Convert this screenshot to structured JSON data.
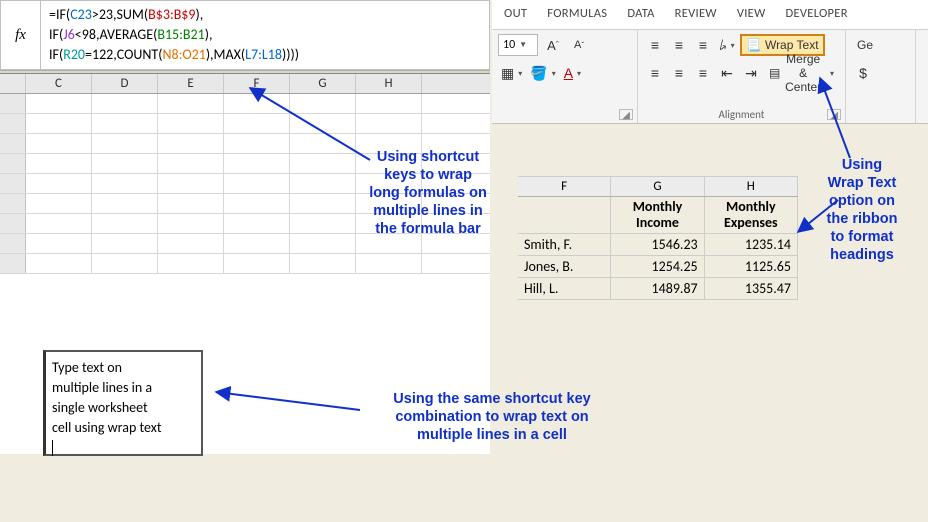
{
  "left": {
    "fx": "fx",
    "line1_pre": "=IF(",
    "line1_ref1": "C23",
    "line1_mid1": ">23,SUM(",
    "line1_ref2": "B$3:B$9",
    "line1_post": "),",
    "line2_pre": "IF(",
    "line2_ref1": "J6",
    "line2_mid1": "<98,AVERAGE(",
    "line2_ref2": "B15:B21",
    "line2_post": "),",
    "line3_pre": "IF(",
    "line3_ref1": "R20",
    "line3_mid1": "=122,COUNT(",
    "line3_ref2": "N8:O21",
    "line3_mid2": "),MAX(",
    "line3_ref3": "L7:L18",
    "line3_post": "))))",
    "cols": [
      "",
      "C",
      "D",
      "E",
      "F",
      "G",
      "H"
    ]
  },
  "wrap_cell_text": "Type text on\nmultiple lines in a\nsingle worksheet\ncell using wrap text",
  "ribbon": {
    "tabs": [
      "OUT",
      "FORMULAS",
      "DATA",
      "REVIEW",
      "VIEW",
      "DEVELOPER"
    ],
    "font_size": "10",
    "align_label": "Alignment",
    "wrap_text": "Wrap Text",
    "merge_center": "Merge & Center",
    "general_partial": "Ge",
    "dollar": "$"
  },
  "chart_data": {
    "type": "table",
    "columns": [
      "",
      "Monthly Income",
      "Monthly Expenses"
    ],
    "col_letters": [
      "F",
      "G",
      "H"
    ],
    "rows": [
      {
        "name": "Smith, F.",
        "income": "1546.23",
        "expenses": "1235.14"
      },
      {
        "name": "Jones, B.",
        "income": "1254.25",
        "expenses": "1125.65"
      },
      {
        "name": "Hill, L.",
        "income": "1489.87",
        "expenses": "1355.47"
      }
    ]
  },
  "annot": {
    "a1": "Using shortcut\nkeys to wrap\nlong formulas on\nmultiple lines in\nthe formula bar",
    "a2": "Using\nWrap Text\noption on\nthe ribbon\nto format\nheadings",
    "a3": "Using the same shortcut key\ncombination to wrap text on\nmultiple lines in a cell"
  }
}
